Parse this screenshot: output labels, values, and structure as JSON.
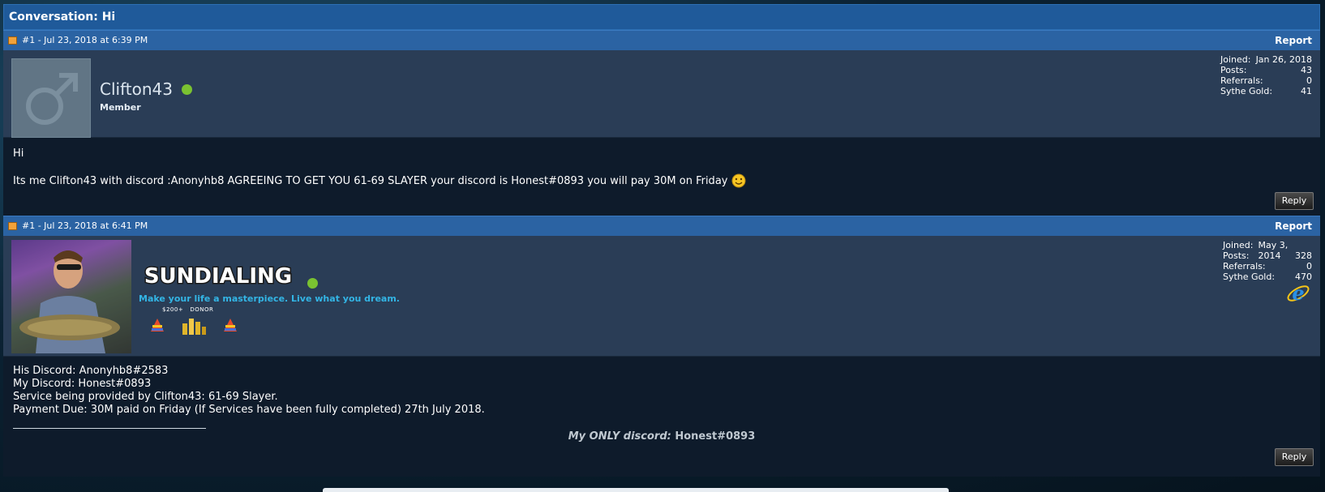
{
  "conversation": {
    "title": "Conversation: Hi"
  },
  "posts": [
    {
      "header": {
        "label": "#1 - Jul 23, 2018 at 6:39 PM",
        "report": "Report"
      },
      "user": {
        "name": "Clifton43",
        "title": "Member",
        "stats": [
          {
            "key": "Joined:",
            "value": "Jan 26, 2018"
          },
          {
            "key": "Posts:",
            "value": "43"
          },
          {
            "key": "Referrals:",
            "value": "0"
          },
          {
            "key": "Sythe Gold:",
            "value": "41"
          }
        ]
      },
      "body": {
        "line1": "Hi",
        "line2": "Its me Clifton43 with discord :Anonyhb8 AGREEING TO GET YOU 61-69 SLAYER your discord is Honest#0893 you will pay 30M on Friday"
      },
      "reply": "Reply"
    },
    {
      "header": {
        "label": "#1 - Jul 23, 2018 at 6:41 PM",
        "report": "Report"
      },
      "user": {
        "name_banner": "SUNDIALING",
        "tagline": "Make your life a masterpiece. Live what you dream.",
        "badge_labels": [
          "$200+",
          "DONOR"
        ],
        "stats": [
          {
            "key": "Joined:",
            "value": "May 3, 2014"
          },
          {
            "key": "Posts:",
            "value": "328"
          },
          {
            "key": "Referrals:",
            "value": "0"
          },
          {
            "key": "Sythe Gold:",
            "value": "470"
          }
        ],
        "browser_icon": "internet-explorer-icon"
      },
      "body": {
        "lines": [
          "His Discord: Anonyhb8#2583",
          "My Discord: Honest#0893",
          "Service being provided by Clifton43: 61-69 Slayer.",
          "Payment Due: 30M paid on Friday (If Services have been fully completed) 27th July 2018."
        ],
        "signature_prefix": "My ONLY discord:",
        "signature_value": "Honest#0893"
      },
      "reply": "Reply"
    }
  ],
  "colors": {
    "title_bar": "#1f5a9a",
    "post_header": "#2b63a3",
    "user_bar": "#2a3d56",
    "post_body": "#0e1b2b",
    "online": "#7ac231",
    "tagline": "#33b5e5"
  }
}
